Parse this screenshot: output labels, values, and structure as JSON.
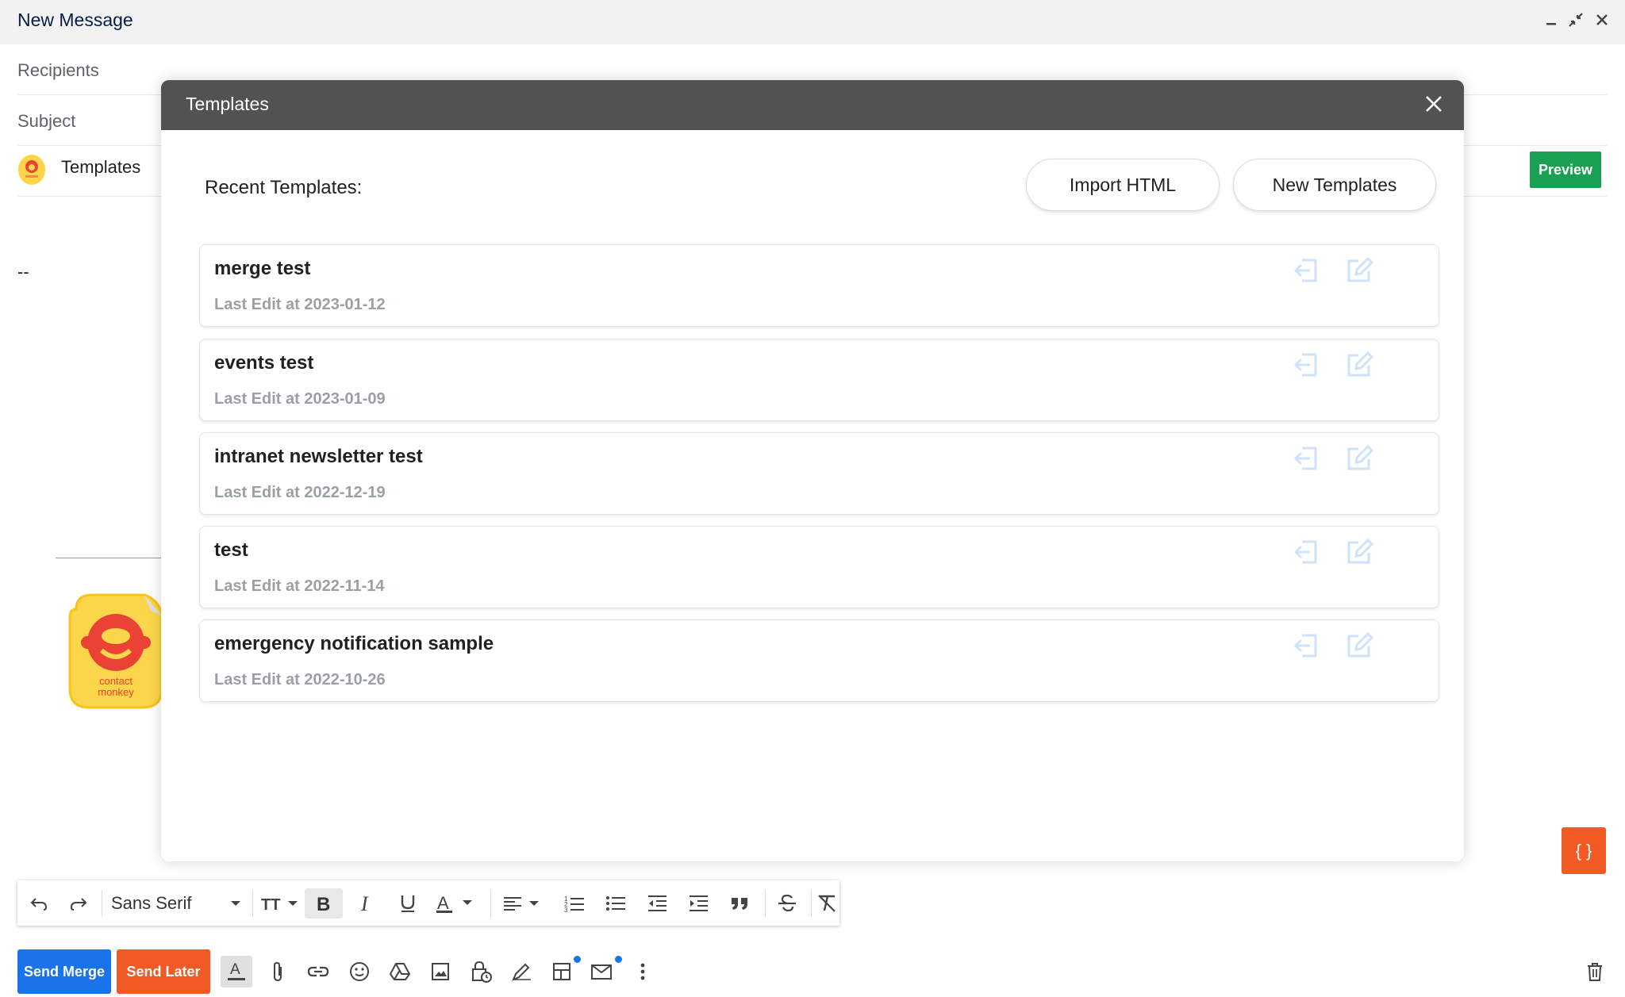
{
  "window": {
    "title": "New Message"
  },
  "fields": {
    "recipients": "Recipients",
    "subject": "Subject",
    "templates": "Templates",
    "preview": "Preview"
  },
  "body": {
    "signature_dashes": "--",
    "logo_text": "contact monkey"
  },
  "modal": {
    "title": "Templates",
    "recent_label": "Recent Templates:",
    "import_button": "Import HTML",
    "new_button": "New Templates",
    "templates": [
      {
        "name": "merge test",
        "last_edit": "Last Edit at 2023-01-12"
      },
      {
        "name": "events test",
        "last_edit": "Last Edit at 2023-01-09"
      },
      {
        "name": "intranet newsletter test",
        "last_edit": "Last Edit at 2022-12-19"
      },
      {
        "name": "test",
        "last_edit": "Last Edit at 2022-11-14"
      },
      {
        "name": "emergency notification sample",
        "last_edit": "Last Edit at 2022-10-26"
      }
    ]
  },
  "toolbar": {
    "font": "Sans Serif",
    "fab_label": "{ }"
  },
  "actions": {
    "send_merge": "Send Merge",
    "send_later": "Send Later"
  },
  "colors": {
    "send_merge": "#1a73e8",
    "send_later": "#f15a24",
    "preview": "#1aa053",
    "modal_header": "#525252",
    "card_icon": "#cfe2fb"
  }
}
